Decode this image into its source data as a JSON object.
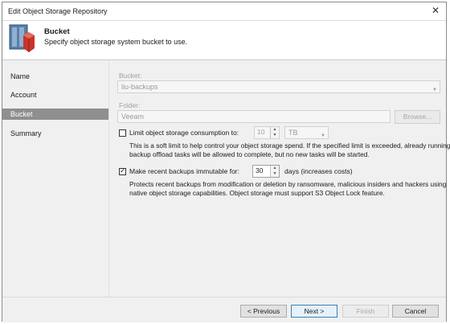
{
  "window": {
    "title": "Edit Object Storage Repository",
    "close_glyph": "✕"
  },
  "header": {
    "title": "Bucket",
    "subtitle": "Specify object storage system bucket to use.",
    "icon": "object-storage-repository-icon"
  },
  "sidebar": {
    "items": [
      {
        "label": "Name",
        "active": false
      },
      {
        "label": "Account",
        "active": false
      },
      {
        "label": "Bucket",
        "active": true
      },
      {
        "label": "Summary",
        "active": false
      }
    ]
  },
  "bucket": {
    "label": "Bucket:",
    "value": "liu-backups"
  },
  "folder": {
    "label": "Folder:",
    "value": "Veeam",
    "browse": "Browse..."
  },
  "limit": {
    "label": "Limit object storage consumption to:",
    "checked": false,
    "value": "10",
    "unit": "TB",
    "desc": "This is a soft limit to help control your object storage spend. If the specified limit is exceeded, already running backup offload tasks will be allowed to complete, but no new tasks will be started."
  },
  "immutable": {
    "label": "Make recent backups immutable for:",
    "checked": true,
    "value": "30",
    "unit": "days (increases costs)",
    "desc": "Protects recent backups from modification or deletion by ransomware, malicious insiders and hackers using native object storage capabilities. Object storage must support S3 Object Lock feature."
  },
  "footer": {
    "previous": "< Previous",
    "next": "Next >",
    "finish": "Finish",
    "cancel": "Cancel"
  },
  "colors": {
    "sidebar_active": "#8f8f8f",
    "panel_bg": "#f0f0f0",
    "logo_red": "#c8352b"
  }
}
